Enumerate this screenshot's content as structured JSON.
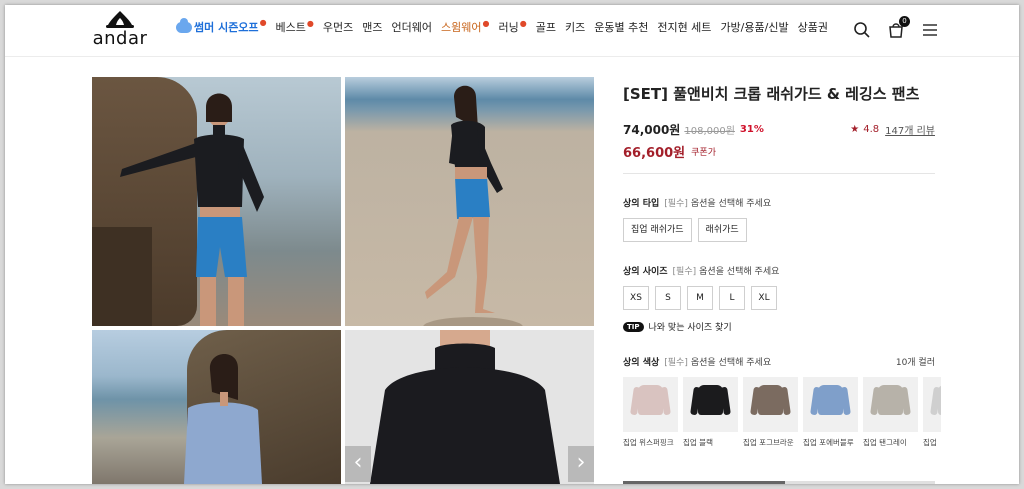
{
  "header": {
    "logo": "andar",
    "nav": [
      {
        "label": "썸머 시즌오프",
        "kind": "summer",
        "dot": true
      },
      {
        "label": "베스트",
        "kind": "normal",
        "dot": true
      },
      {
        "label": "우먼즈",
        "kind": "normal",
        "dot": false
      },
      {
        "label": "맨즈",
        "kind": "normal",
        "dot": false
      },
      {
        "label": "언더웨어",
        "kind": "normal",
        "dot": false
      },
      {
        "label": "스윔웨어",
        "kind": "highlight",
        "dot": true
      },
      {
        "label": "러닝",
        "kind": "normal",
        "dot": true
      },
      {
        "label": "골프",
        "kind": "normal",
        "dot": false
      },
      {
        "label": "키즈",
        "kind": "normal",
        "dot": false
      },
      {
        "label": "운동별 추천",
        "kind": "normal",
        "dot": false
      },
      {
        "label": "전지현 세트",
        "kind": "normal",
        "dot": false
      },
      {
        "label": "가방/용품/신발",
        "kind": "normal",
        "dot": false
      },
      {
        "label": "상품권",
        "kind": "normal",
        "dot": false
      }
    ],
    "cart_count": "0",
    "icons": [
      "search-icon",
      "cart-icon",
      "menu-icon"
    ]
  },
  "gallery": {
    "prev_arrow": "‹",
    "next_arrow": "›"
  },
  "product": {
    "title": "[SET] 풀앤비치 크롭 래쉬가드 & 레깅스 팬츠",
    "price": "74,000원",
    "original_price": "108,000원",
    "discount": "31%",
    "rating_star": "★",
    "rating": "4.8",
    "reviews": "147개 리뷰",
    "coupon_price": "66,600원",
    "coupon_label": "쿠폰가"
  },
  "options": {
    "top_type": {
      "label": "상의 타입",
      "required": "[필수]",
      "hint": "옵션을 선택해 주세요",
      "values": [
        "집업 래쉬가드",
        "래쉬가드"
      ]
    },
    "top_size": {
      "label": "상의 사이즈",
      "required": "[필수]",
      "hint": "옵션을 선택해 주세요",
      "values": [
        "XS",
        "S",
        "M",
        "L",
        "XL"
      ]
    },
    "tip": {
      "badge": "TIP",
      "text": "나와 맞는 사이즈 찾기"
    },
    "top_color": {
      "label": "상의 색상",
      "required": "[필수]",
      "hint": "옵션을 선택해 주세요",
      "count": "10개 컬러",
      "values": [
        {
          "name": "집업 위스퍼핑크",
          "color": "#d9c3c0"
        },
        {
          "name": "집업 블랙",
          "color": "#1b1b1d"
        },
        {
          "name": "집업 포그브라운",
          "color": "#7b6b60"
        },
        {
          "name": "집업 포에버블루",
          "color": "#7f9fca"
        },
        {
          "name": "집업 탠그레이",
          "color": "#b7b2a9"
        },
        {
          "name": "집업",
          "color": "#cfcfcf"
        }
      ]
    }
  },
  "colors": {
    "accent": "#a31f2a",
    "highlight_nav": "#c8651b",
    "summer_nav": "#1e6fd9"
  }
}
